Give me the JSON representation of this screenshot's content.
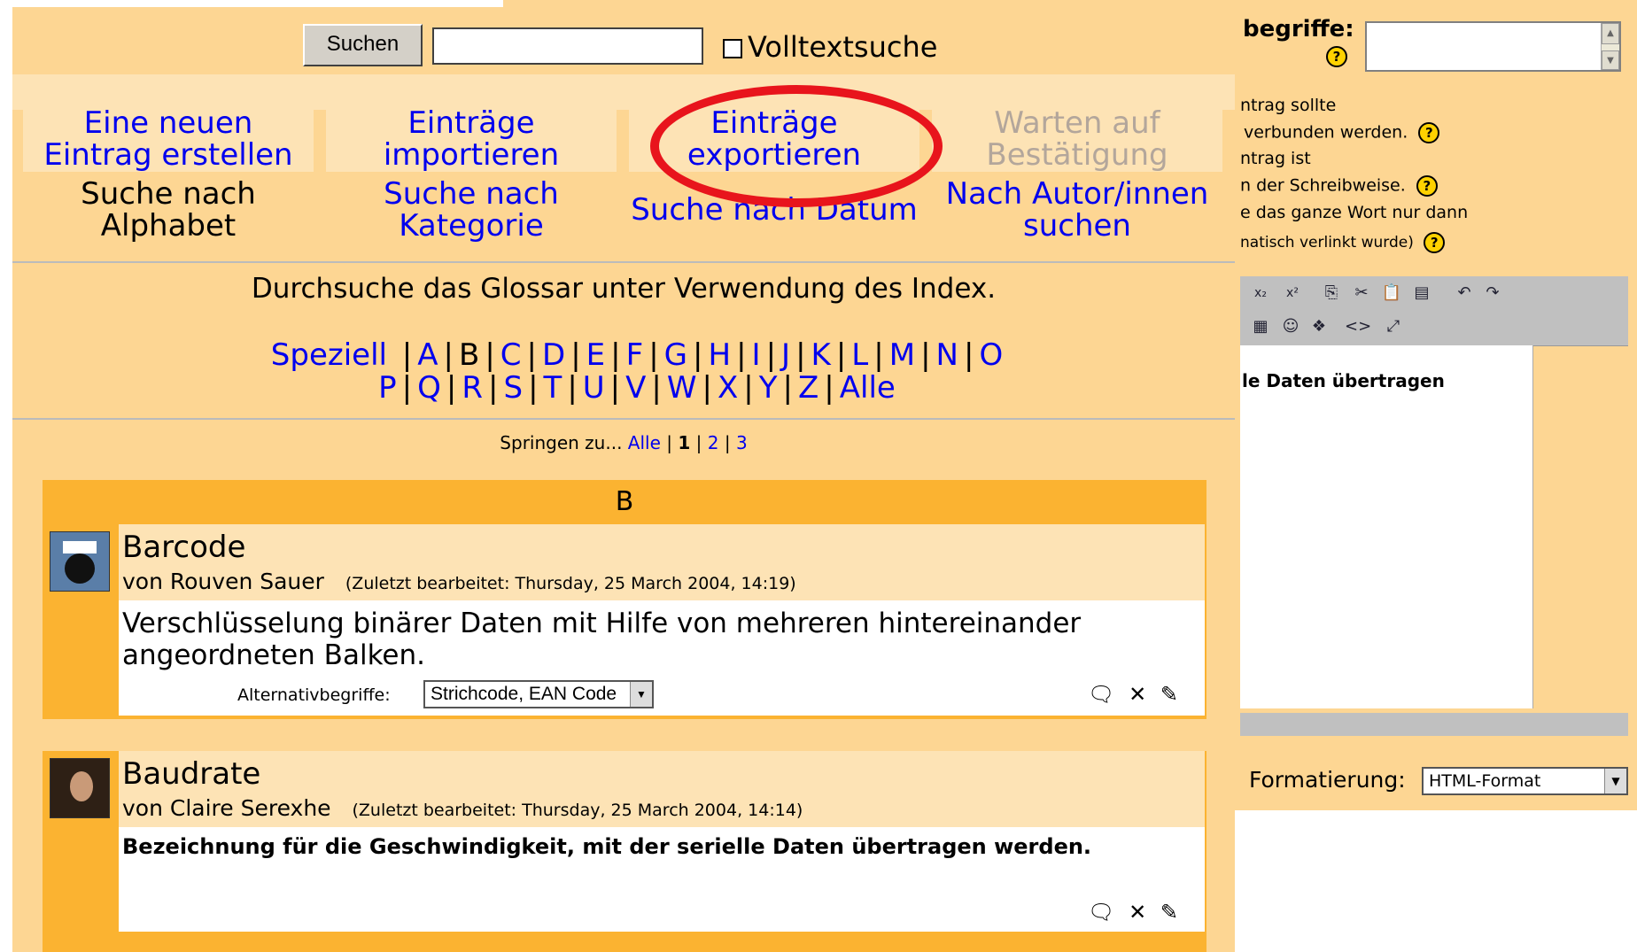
{
  "search": {
    "button_label": "Suchen",
    "input_value": "",
    "fulltext_label": "Volltextsuche"
  },
  "tabs": {
    "new_entry": "Eine neuen\nEintrag erstellen",
    "import": "Einträge\nimportieren",
    "export": "Einträge\nexportieren",
    "pending": "Warten auf\nBestätigung",
    "by_alphabet": "Suche nach\nAlphabet",
    "by_category": "Suche nach\nKategorie",
    "by_date": "Suche nach Datum",
    "by_author": "Nach Autor/innen\nsuchen"
  },
  "index": {
    "intro": "Durchsuche das Glossar unter Verwendung des Index.",
    "special": "Speziell",
    "row1": [
      "A",
      "B",
      "C",
      "D",
      "E",
      "F",
      "G",
      "H",
      "I",
      "J",
      "K",
      "L",
      "M",
      "N",
      "O"
    ],
    "row2": [
      "P",
      "Q",
      "R",
      "S",
      "T",
      "U",
      "V",
      "W",
      "X",
      "Y",
      "Z"
    ],
    "all": "Alle",
    "current": "B"
  },
  "jump": {
    "label": "Springen zu...",
    "all": "Alle",
    "pages": [
      "1",
      "2",
      "3"
    ],
    "current_page": "1"
  },
  "category_header": "B",
  "entries": [
    {
      "concept": "Barcode",
      "author": "von Rouven Sauer",
      "edited": "(Zuletzt bearbeitet: Thursday, 25 March 2004, 14:19)",
      "definition": "Verschlüsselung binärer Daten mit Hilfe von mehreren hintereinander angeordneten Balken.",
      "alias_label": "Alternativbegriffe:",
      "alias_value": "Strichcode, EAN Code"
    },
    {
      "concept": "Baudrate",
      "author": "von Claire Serexhe",
      "edited": "(Zuletzt bearbeitet: Thursday, 25 March 2004, 14:14)",
      "definition": "Bezeichnung für die Geschwindigkeit, mit der serielle Daten übertragen werden."
    }
  ],
  "right_panel": {
    "aliases_label": "begriffe:",
    "line1": "ntrag sollte",
    "line2": "verbunden werden.",
    "line3": "ntrag ist",
    "line4": "n der Schreibweise.",
    "line5": "e das ganze Wort nur dann",
    "line6": "natisch verlinkt wurde)",
    "editor_text": "le Daten übertragen",
    "format_label": "Formatierung:",
    "format_value": "HTML-Format"
  },
  "colors": {
    "panel_bg": "#fdd693",
    "header_bg": "#fbb331",
    "link": "#0000ee",
    "highlight_circle": "#e8141c"
  }
}
